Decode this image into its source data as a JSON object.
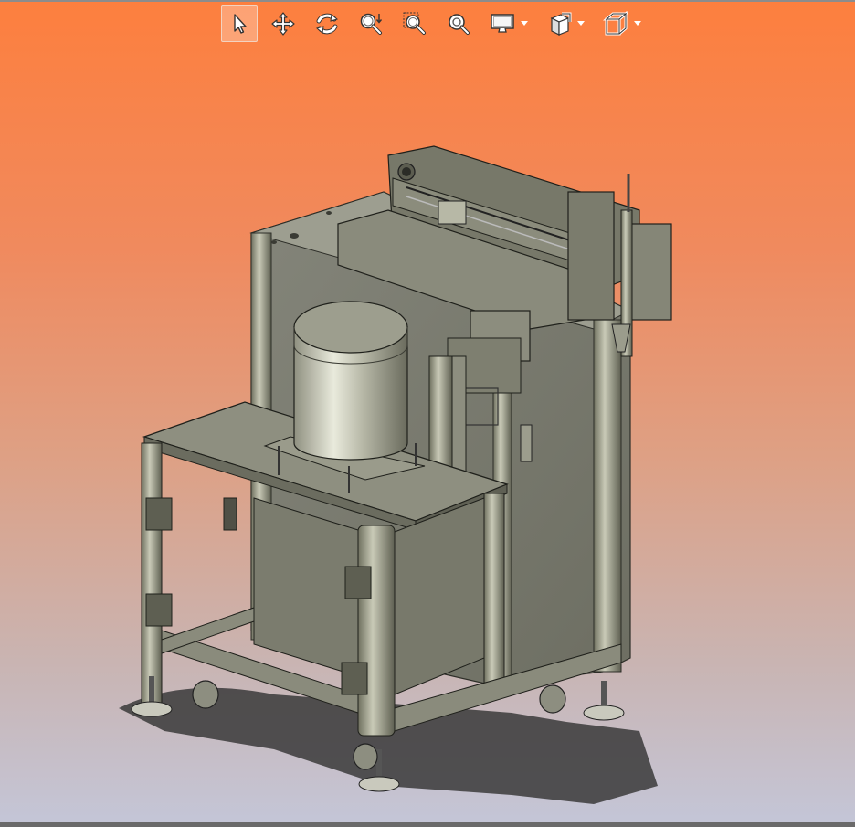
{
  "window": {
    "kind": "3d-cad-viewport",
    "background_top": "#fd7f3e",
    "background_bottom": "#c4c6d8"
  },
  "toolbar": {
    "items": [
      {
        "name": "select",
        "icon": "select-arrow-icon",
        "active": true
      },
      {
        "name": "pan",
        "icon": "pan-move-icon",
        "active": false
      },
      {
        "name": "rotate",
        "icon": "rotate-icon",
        "active": false
      },
      {
        "name": "zoom-in-out",
        "icon": "zoom-in-out-icon",
        "active": false
      },
      {
        "name": "zoom-to-area",
        "icon": "zoom-to-area-icon",
        "active": false
      },
      {
        "name": "zoom-to-fit",
        "icon": "zoom-to-fit-icon",
        "active": false
      },
      {
        "name": "display-style",
        "icon": "display-style-icon",
        "active": false,
        "dropdown": true
      },
      {
        "name": "view-orientation",
        "icon": "view-orientation-icon",
        "active": false,
        "dropdown": true
      },
      {
        "name": "standard-views",
        "icon": "standard-views-icon",
        "active": false,
        "dropdown": true
      }
    ]
  },
  "model": {
    "description_icon": "machine-assembly-model",
    "color": "#7c7d6e"
  }
}
